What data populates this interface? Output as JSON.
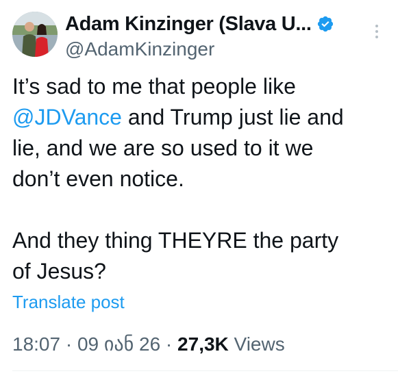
{
  "author": {
    "display_name": "Adam Kinzinger (Slava U...",
    "handle": "@AdamKinzinger",
    "verified": true,
    "avatar_icon": "profile-photo"
  },
  "post": {
    "line1_before": "It’s sad to me that people like",
    "mention": "@JDVance",
    "line_after_mention": " and Trump just lie and\nlie, and we are so used to it we\ndon’t even notice.\n\nAnd they thing THEYRE the party\nof Jesus?"
  },
  "translate_label": "Translate post",
  "meta": {
    "time": "18:07",
    "sep1": " · ",
    "date": "09 იან 26",
    "sep2": " · ",
    "views_count": "27,3K",
    "views_label": " Views"
  },
  "colors": {
    "link": "#1d9bf0",
    "text": "#0f1419",
    "muted": "#536471",
    "verified_badge": "#1d9bf0"
  }
}
